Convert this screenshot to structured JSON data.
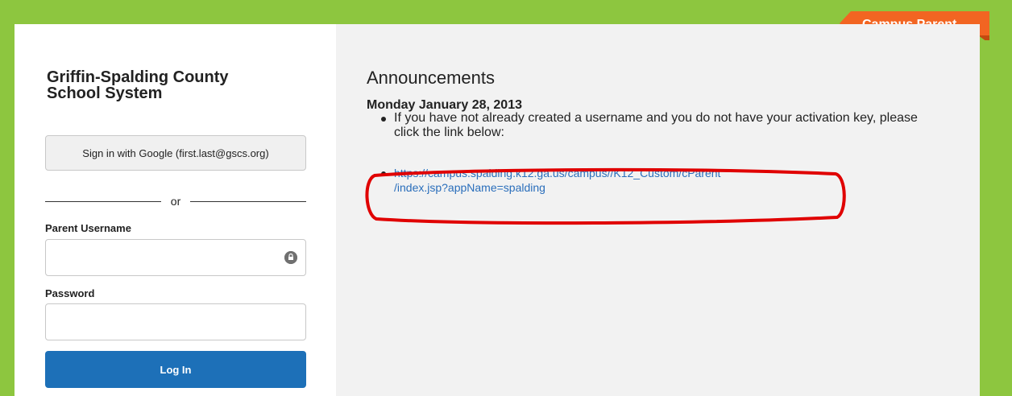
{
  "brand": {
    "ribbon_label": "Campus Parent",
    "colors": {
      "page_bg": "#8dc63f",
      "ribbon": "#f26522",
      "primary_button": "#1d70b8",
      "link": "#2a6ebb",
      "highlight": "#e00000"
    }
  },
  "login": {
    "school_name_line1": "Griffin-Spalding County",
    "school_name_line2": "School System",
    "google_button_label": "Sign in with Google (first.last@gscs.org)",
    "divider_text": "or",
    "username_label": "Parent Username",
    "username_value": "",
    "username_icon": "lock-icon",
    "password_label": "Password",
    "password_value": "",
    "login_button_label": "Log In"
  },
  "announcements": {
    "title": "Announcements",
    "date": "Monday January 28, 2013",
    "items": [
      {
        "text": "If you have not already created a username and you do not have your activation key, please click the link below:"
      }
    ],
    "link_line1": "https://campus.spalding.k12.ga.us/campus//K12_Custom/cParent",
    "link_line2": "/index.jsp?appName=spalding"
  }
}
